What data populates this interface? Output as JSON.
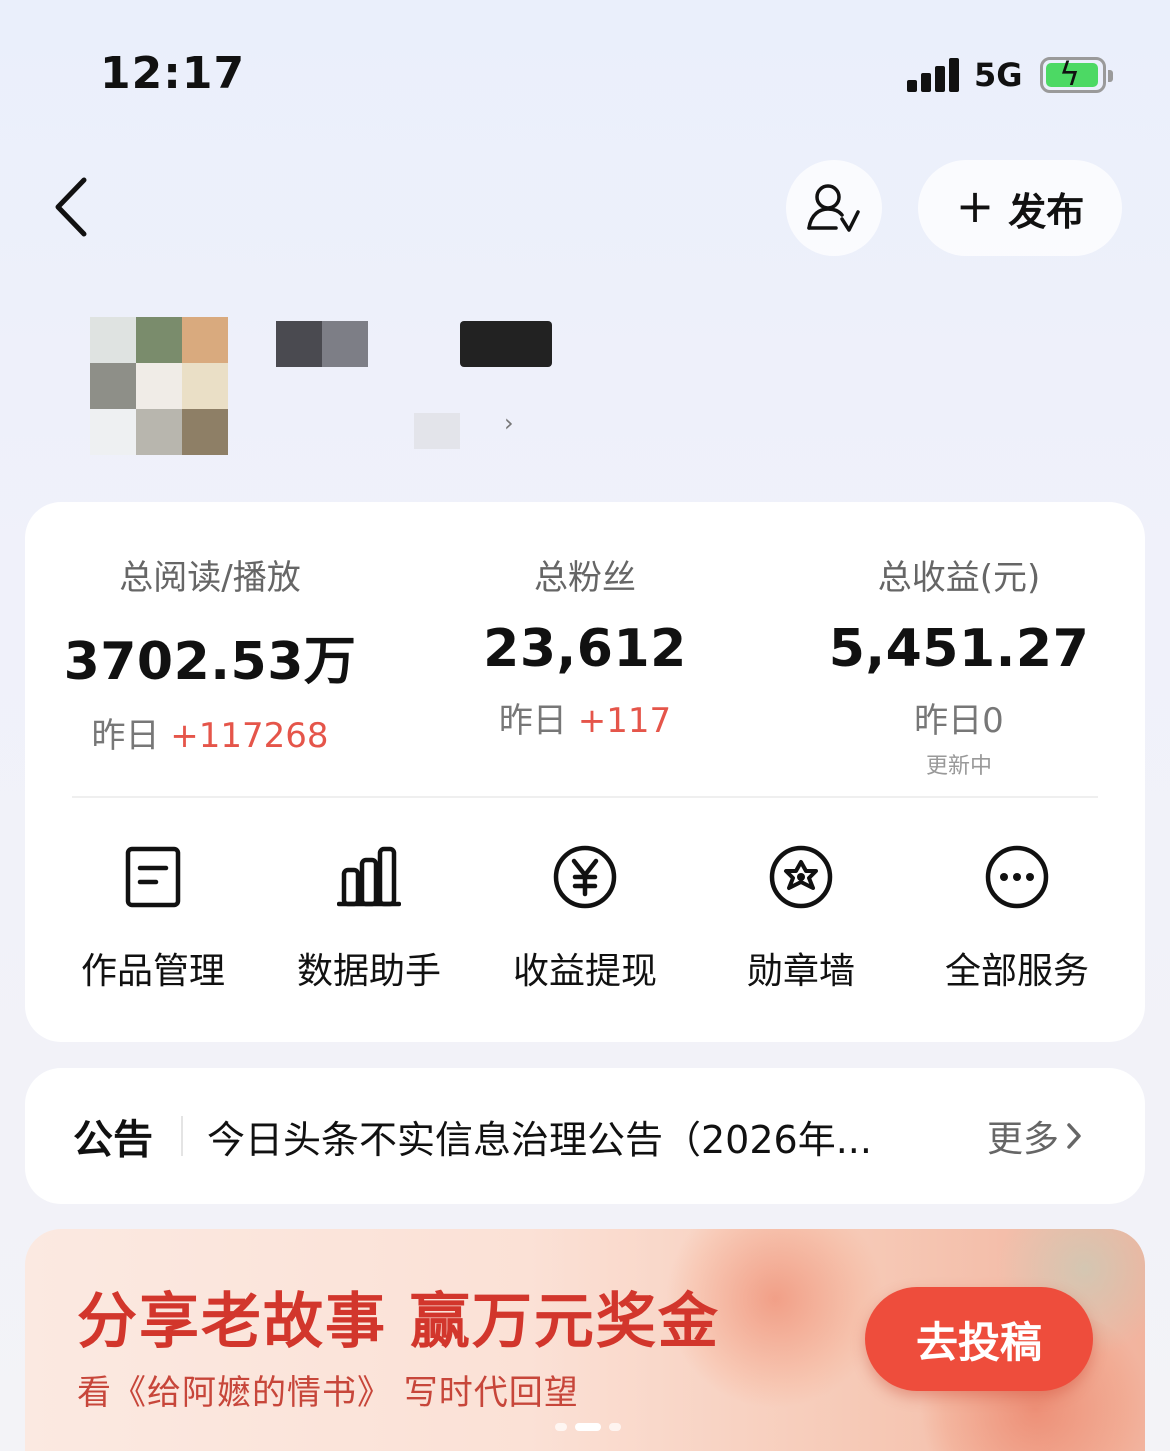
{
  "status_bar": {
    "time": "12:17",
    "network": "5G"
  },
  "header": {
    "publish_label": "发布"
  },
  "stats": [
    {
      "label": "总阅读/播放",
      "value": "3702.53万",
      "delta_prefix": "昨日 ",
      "delta_value": "+117268",
      "sub": ""
    },
    {
      "label": "总粉丝",
      "value": "23,612",
      "delta_prefix": "昨日 ",
      "delta_value": "+117",
      "sub": ""
    },
    {
      "label": "总收益(元)",
      "value": "5,451.27",
      "delta_prefix": "昨日0",
      "delta_value": "",
      "sub": "更新中"
    }
  ],
  "services": [
    {
      "label": "作品管理",
      "icon": "document-icon"
    },
    {
      "label": "数据助手",
      "icon": "bar-chart-icon"
    },
    {
      "label": "收益提现",
      "icon": "yuan-icon"
    },
    {
      "label": "勋章墙",
      "icon": "medal-icon"
    },
    {
      "label": "全部服务",
      "icon": "more-icon"
    }
  ],
  "notice": {
    "tag": "公告",
    "text": "今日头条不实信息治理公告（2026年...",
    "more": "更多"
  },
  "banner": {
    "title": "分享老故事 赢万元奖金",
    "subtitle": "看《给阿嬷的情书》 写时代回望",
    "cta": "去投稿"
  },
  "colors": {
    "accent_red": "#e5554a",
    "cta": "#ee4d3c",
    "banner_title": "#d2362c"
  }
}
